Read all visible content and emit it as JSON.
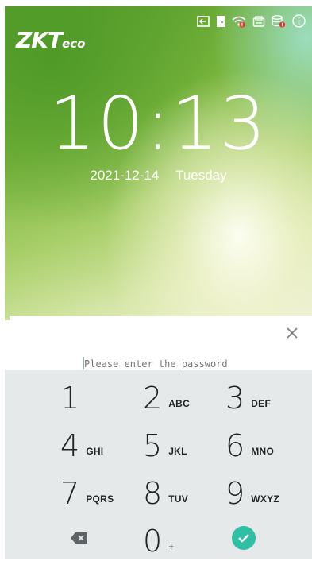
{
  "logo": {
    "brand": "ZKT",
    "suffix": "eco"
  },
  "status_icons": [
    "logout-icon",
    "door-icon",
    "wifi-warning-icon",
    "printer-icon",
    "database-warning-icon",
    "info-icon"
  ],
  "clock": {
    "time": "10:13",
    "date": "2021-12-14",
    "weekday": "Tuesday"
  },
  "password": {
    "placeholder": "Please enter the password",
    "value": ""
  },
  "keypad": {
    "k1": {
      "num": "1",
      "letters": ""
    },
    "k2": {
      "num": "2",
      "letters": "ABC"
    },
    "k3": {
      "num": "3",
      "letters": "DEF"
    },
    "k4": {
      "num": "4",
      "letters": "GHI"
    },
    "k5": {
      "num": "5",
      "letters": "JKL"
    },
    "k6": {
      "num": "6",
      "letters": "MNO"
    },
    "k7": {
      "num": "7",
      "letters": "PQRS"
    },
    "k8": {
      "num": "8",
      "letters": "TUV"
    },
    "k9": {
      "num": "9",
      "letters": "WXYZ"
    },
    "k0": {
      "num": "0",
      "letters": "+"
    }
  },
  "colors": {
    "accent": "#2fbfa4",
    "warning": "#e0302f",
    "keypad_bg": "#e6e9e9"
  }
}
